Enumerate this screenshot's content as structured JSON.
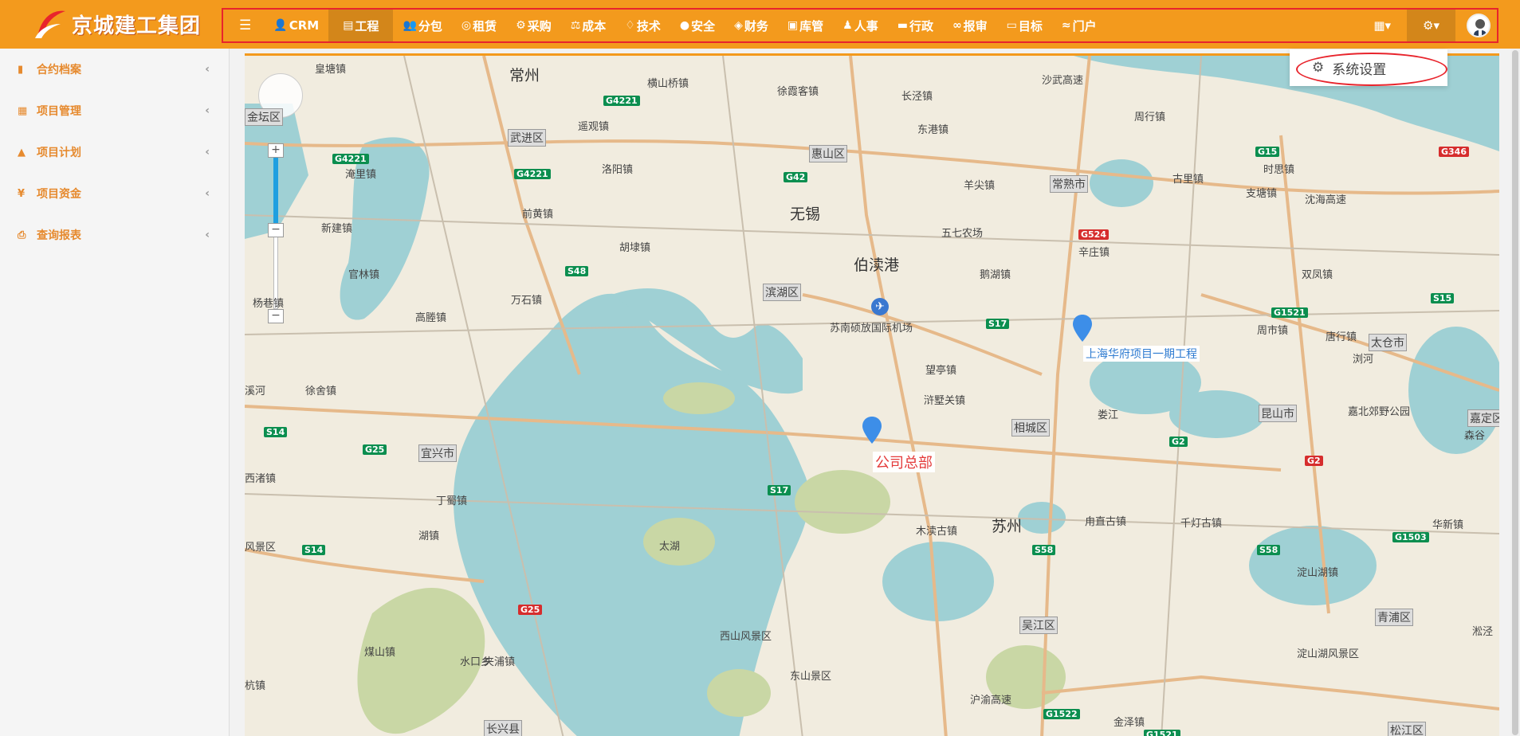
{
  "app": {
    "logo_text": "京城建工集团"
  },
  "nav": {
    "items": [
      {
        "icon": "☰",
        "label": ""
      },
      {
        "icon": "👤",
        "label": "CRM"
      },
      {
        "icon": "▤",
        "label": "工程"
      },
      {
        "icon": "👥",
        "label": "分包"
      },
      {
        "icon": "◎",
        "label": "租赁"
      },
      {
        "icon": "⚙",
        "label": "采购"
      },
      {
        "icon": "⚖",
        "label": "成本"
      },
      {
        "icon": "♢",
        "label": "技术"
      },
      {
        "icon": "●",
        "label": "安全"
      },
      {
        "icon": "◈",
        "label": "财务"
      },
      {
        "icon": "▣",
        "label": "库管"
      },
      {
        "icon": "♟",
        "label": "人事"
      },
      {
        "icon": "▬",
        "label": "行政"
      },
      {
        "icon": "∞",
        "label": "报审"
      },
      {
        "icon": "▭",
        "label": "目标"
      },
      {
        "icon": "≈",
        "label": "门户"
      }
    ],
    "active_index": 2,
    "right": {
      "calc_icon": "▦▾",
      "settings_icon": "⚙▾"
    }
  },
  "dropdown": {
    "item_label": "系统设置"
  },
  "sidebar": {
    "items": [
      {
        "icon": "▮",
        "label": "合约档案"
      },
      {
        "icon": "▦",
        "label": "项目管理"
      },
      {
        "icon": "▲",
        "label": "项目计划"
      },
      {
        "icon": "¥",
        "label": "项目资金"
      },
      {
        "icon": "⎙",
        "label": "查询报表"
      }
    ]
  },
  "map": {
    "markers": [
      {
        "label": "公司总部"
      },
      {
        "label": "上海华府项目一期工程"
      }
    ],
    "places": [
      {
        "name": "常州",
        "size": "big"
      },
      {
        "name": "无锡",
        "size": "big"
      },
      {
        "name": "苏州",
        "size": "big"
      },
      {
        "name": "太湖",
        "size": "normal"
      },
      {
        "name": "伯渎港",
        "size": "big"
      },
      {
        "name": "苏南硕放国际机场",
        "size": "normal"
      },
      {
        "name": "皇塘镇",
        "size": "normal"
      },
      {
        "name": "横山桥镇",
        "size": "normal"
      },
      {
        "name": "徐霞客镇",
        "size": "normal"
      },
      {
        "name": "长泾镇",
        "size": "normal"
      },
      {
        "name": "沙武高速",
        "size": "normal"
      },
      {
        "name": "遥观镇",
        "size": "normal"
      },
      {
        "name": "洛阳镇",
        "size": "normal"
      },
      {
        "name": "东港镇",
        "size": "normal"
      },
      {
        "name": "周行镇",
        "size": "normal"
      },
      {
        "name": "古里镇",
        "size": "normal"
      },
      {
        "name": "时思镇",
        "size": "normal"
      },
      {
        "name": "淹里镇",
        "size": "normal"
      },
      {
        "name": "羊尖镇",
        "size": "normal"
      },
      {
        "name": "支塘镇",
        "size": "normal"
      },
      {
        "name": "沈海高速",
        "size": "normal"
      },
      {
        "name": "前黄镇",
        "size": "normal"
      },
      {
        "name": "新建镇",
        "size": "normal"
      },
      {
        "name": "胡埭镇",
        "size": "normal"
      },
      {
        "name": "五七农场",
        "size": "normal"
      },
      {
        "name": "辛庄镇",
        "size": "normal"
      },
      {
        "name": "双凤镇",
        "size": "normal"
      },
      {
        "name": "官林镇",
        "size": "normal"
      },
      {
        "name": "鹅湖镇",
        "size": "normal"
      },
      {
        "name": "杨巷镇",
        "size": "normal"
      },
      {
        "name": "万石镇",
        "size": "normal"
      },
      {
        "name": "周市镇",
        "size": "normal"
      },
      {
        "name": "唐行镇",
        "size": "normal"
      },
      {
        "name": "高塍镇",
        "size": "normal"
      },
      {
        "name": "望亭镇",
        "size": "normal"
      },
      {
        "name": "浏河",
        "size": "normal"
      },
      {
        "name": "徐舍镇",
        "size": "normal"
      },
      {
        "name": "浒墅关镇",
        "size": "normal"
      },
      {
        "name": "娄江",
        "size": "normal"
      },
      {
        "name": "嘉北郊野公园",
        "size": "normal"
      },
      {
        "name": "森谷",
        "size": "normal"
      },
      {
        "name": "西渚镇",
        "size": "normal"
      },
      {
        "name": "丁蜀镇",
        "size": "normal"
      },
      {
        "name": "湖镇",
        "size": "normal"
      },
      {
        "name": "木渎古镇",
        "size": "normal"
      },
      {
        "name": "甪直古镇",
        "size": "normal"
      },
      {
        "name": "千灯古镇",
        "size": "normal"
      },
      {
        "name": "华新镇",
        "size": "normal"
      },
      {
        "name": "风景区",
        "size": "normal"
      },
      {
        "name": "淀山湖镇",
        "size": "normal"
      },
      {
        "name": "西山风景区",
        "size": "normal"
      },
      {
        "name": "淀山湖风景区",
        "size": "normal"
      },
      {
        "name": "煤山镇",
        "size": "normal"
      },
      {
        "name": "水口乡",
        "size": "normal"
      },
      {
        "name": "夹浦镇",
        "size": "normal"
      },
      {
        "name": "东山景区",
        "size": "normal"
      },
      {
        "name": "沪渝高速",
        "size": "normal"
      },
      {
        "name": "金泽镇",
        "size": "normal"
      },
      {
        "name": "杭镇",
        "size": "normal"
      },
      {
        "name": "溪河",
        "size": "normal"
      },
      {
        "name": "淞泾",
        "size": "normal"
      }
    ],
    "boxed": [
      "武进区",
      "惠山区",
      "常熟市",
      "滨湖区",
      "太仓市",
      "昆山市",
      "嘉定区",
      "相城区",
      "宜兴市",
      "吴江区",
      "青浦区",
      "长兴县",
      "松江区",
      "金坛区"
    ],
    "shields": [
      {
        "code": "G4221",
        "color": "g"
      },
      {
        "code": "G346",
        "color": "r"
      },
      {
        "code": "G15",
        "color": "g"
      },
      {
        "code": "G42",
        "color": "g"
      },
      {
        "code": "G524",
        "color": "r"
      },
      {
        "code": "S48",
        "color": "g"
      },
      {
        "code": "S17",
        "color": "g"
      },
      {
        "code": "G1521",
        "color": "g"
      },
      {
        "code": "S14",
        "color": "g"
      },
      {
        "code": "G25",
        "color": "g"
      },
      {
        "code": "S58",
        "color": "g"
      },
      {
        "code": "G1503",
        "color": "g"
      },
      {
        "code": "G1522",
        "color": "g"
      },
      {
        "code": "G2",
        "color": "g"
      },
      {
        "code": "G346",
        "color": "r"
      },
      {
        "code": "G4221",
        "color": "g"
      },
      {
        "code": "S17",
        "color": "g"
      },
      {
        "code": "S58",
        "color": "g"
      },
      {
        "code": "G25",
        "color": "r"
      },
      {
        "code": "S14",
        "color": "g"
      },
      {
        "code": "G1521",
        "color": "g"
      },
      {
        "code": "S15",
        "color": "g"
      },
      {
        "code": "G2",
        "color": "r"
      },
      {
        "code": "G4221",
        "color": "g"
      }
    ]
  }
}
